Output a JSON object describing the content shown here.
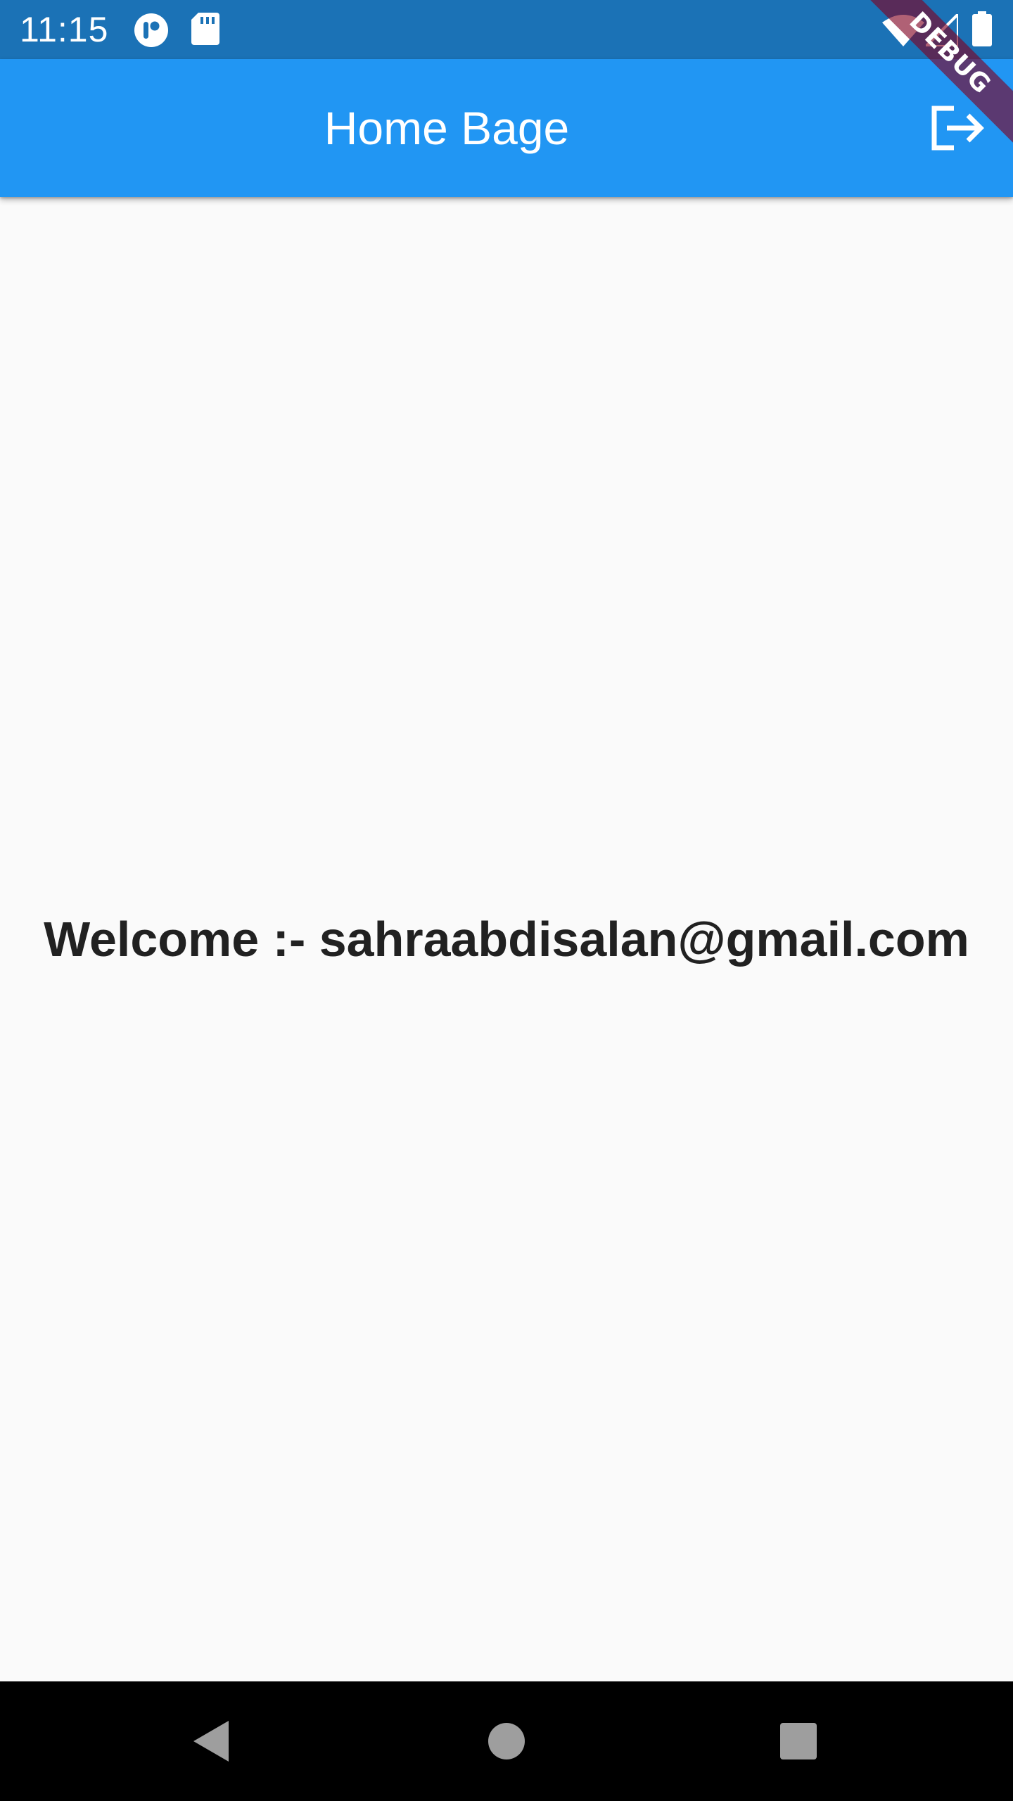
{
  "status_bar": {
    "time": "11:15",
    "background": "#1b72b6",
    "left_icons": [
      "notification-app-icon",
      "sd-card-icon"
    ],
    "right_icons": [
      "wifi-icon",
      "signal-icon",
      "battery-icon"
    ]
  },
  "debug_banner": {
    "label": "DEBUG"
  },
  "app_bar": {
    "title": "Home Bage",
    "background": "#2196f3",
    "action_icon": "logout-icon"
  },
  "content": {
    "welcome_text": "Welcome :- sahraabdisalan@gmail.com"
  },
  "nav_bar": {
    "buttons": [
      "back-icon",
      "home-icon",
      "recents-icon"
    ]
  },
  "colors": {
    "accent": "#2196f3",
    "status": "#1b72b6",
    "text": "#212121",
    "background": "#fafafa"
  }
}
